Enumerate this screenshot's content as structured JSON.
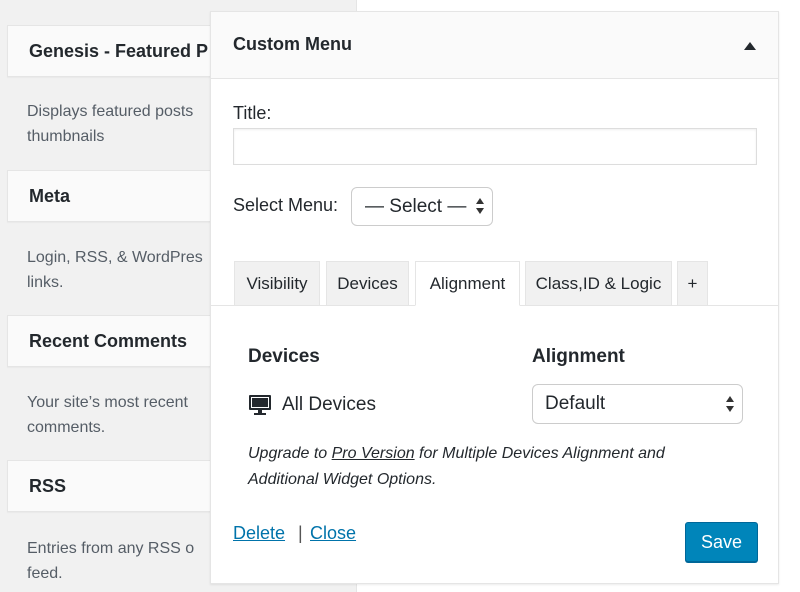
{
  "available_widgets": [
    {
      "title": "Genesis - Featured P",
      "desc_lines": [
        "Displays featured posts",
        "thumbnails"
      ]
    },
    {
      "title": "Meta",
      "desc_lines": [
        "Login, RSS, & WordPres",
        "links."
      ]
    },
    {
      "title": "Recent Comments",
      "desc_lines": [
        "Your site’s most recent",
        "comments."
      ]
    },
    {
      "title": "RSS",
      "desc_lines": [
        "Entries from any RSS o",
        "feed."
      ]
    }
  ],
  "widget": {
    "title": "Custom Menu",
    "title_label": "Title:",
    "title_value": "",
    "select_menu_label": "Select Menu:",
    "select_menu_value": "— Select —",
    "tabs": [
      "Visibility",
      "Devices",
      "Alignment",
      "Class,ID & Logic",
      "+"
    ],
    "active_tab": "Alignment",
    "devices_heading": "Devices",
    "alignment_heading": "Alignment",
    "device_option": "All Devices",
    "device_icon": "desktop-monitor-icon",
    "alignment_value": "Default",
    "upgrade_prefix": "Upgrade to ",
    "upgrade_link": "Pro Version",
    "upgrade_suffix": " for Multiple Devices Alignment and Additional Widget Options.",
    "delete_label": "Delete",
    "separator": "|",
    "close_label": "Close",
    "save_label": "Save"
  },
  "colors": {
    "link": "#0073aa",
    "primary_button": "#0085ba",
    "panel_header": "#fafafa",
    "page_bg": "#f1f1f1"
  }
}
